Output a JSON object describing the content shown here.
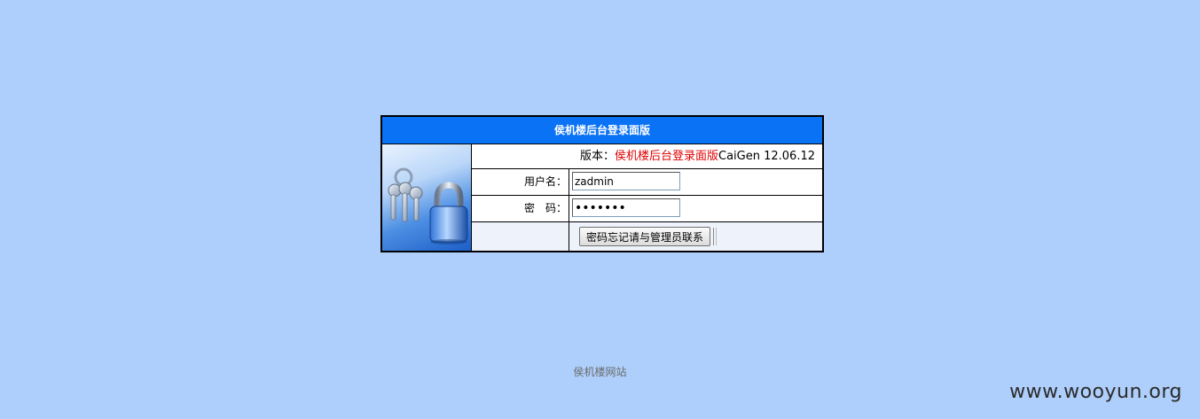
{
  "login": {
    "title": "侯机楼后台登录面版",
    "version_prefix": "版本：",
    "version_name": "侯机楼后台登录面版",
    "version_code": "CaiGen 12.06.12",
    "username_label": "用户名：",
    "username_value": "zadmin",
    "password_label": "密　码：",
    "password_value": "1234567",
    "submit_label": "密码忘记请与管理员联系"
  },
  "footer": {
    "site_name": "侯机楼网站"
  },
  "watermark": "www.wooyun.org",
  "colors": {
    "background": "#aecefb",
    "title_bar": "#0a72f5",
    "version_name": "#e00000",
    "button_row": "#eef3fb"
  },
  "icons": [
    "keys-icon",
    "padlock-icon"
  ]
}
